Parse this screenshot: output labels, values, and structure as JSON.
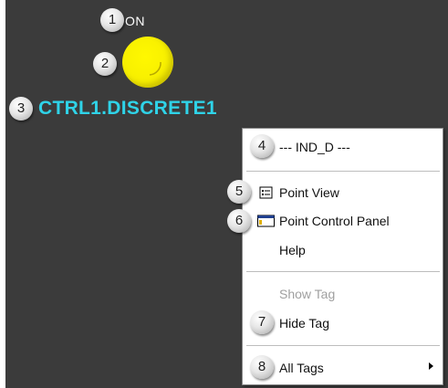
{
  "display": {
    "state_text": "ON",
    "tag_name": "CTRL1.DISCRETE1",
    "indicator_color": "#f7ef00",
    "tag_color": "#2fd3e8",
    "background_color": "#3b3b3b"
  },
  "callouts": [
    "1",
    "2",
    "3",
    "4",
    "5",
    "6",
    "7",
    "8"
  ],
  "menu": {
    "header": "--- IND_D ---",
    "point_view": "Point View",
    "point_control_panel": "Point Control Panel",
    "help": "Help",
    "show_tag": "Show Tag",
    "hide_tag": "Hide Tag",
    "all_tags": "All Tags",
    "icons": {
      "point_view": "point-view-icon",
      "point_control_panel": "control-panel-icon",
      "all_tags": "submenu-arrow-icon"
    }
  }
}
